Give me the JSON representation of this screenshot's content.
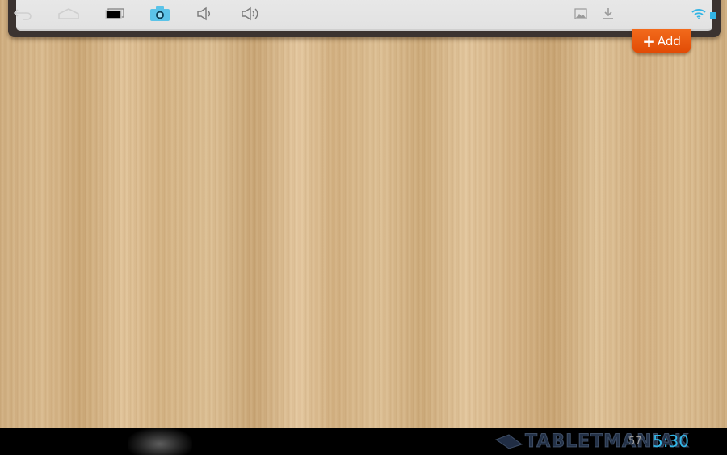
{
  "app": {
    "add_button": {
      "plus": "+",
      "label": "Add"
    }
  },
  "system_bar": {
    "battery_level": "57",
    "clock": "5:30",
    "watermark": "TABLETMANIAK",
    "icons": {
      "back": "back-arrow-icon",
      "home": "home-icon",
      "recents": "recent-apps-icon",
      "screenshot": "camera-icon",
      "volume_down": "volume-down-icon",
      "volume_up": "volume-up-icon",
      "gallery": "gallery-notification-icon",
      "download": "download-icon",
      "wifi": "wifi-icon",
      "battery": "battery-icon"
    }
  },
  "colors": {
    "accent_orange": "#e9570f",
    "clock_blue": "#33b5e5",
    "wood_light": "#dcbf94",
    "frame_dark": "#3b3330"
  }
}
